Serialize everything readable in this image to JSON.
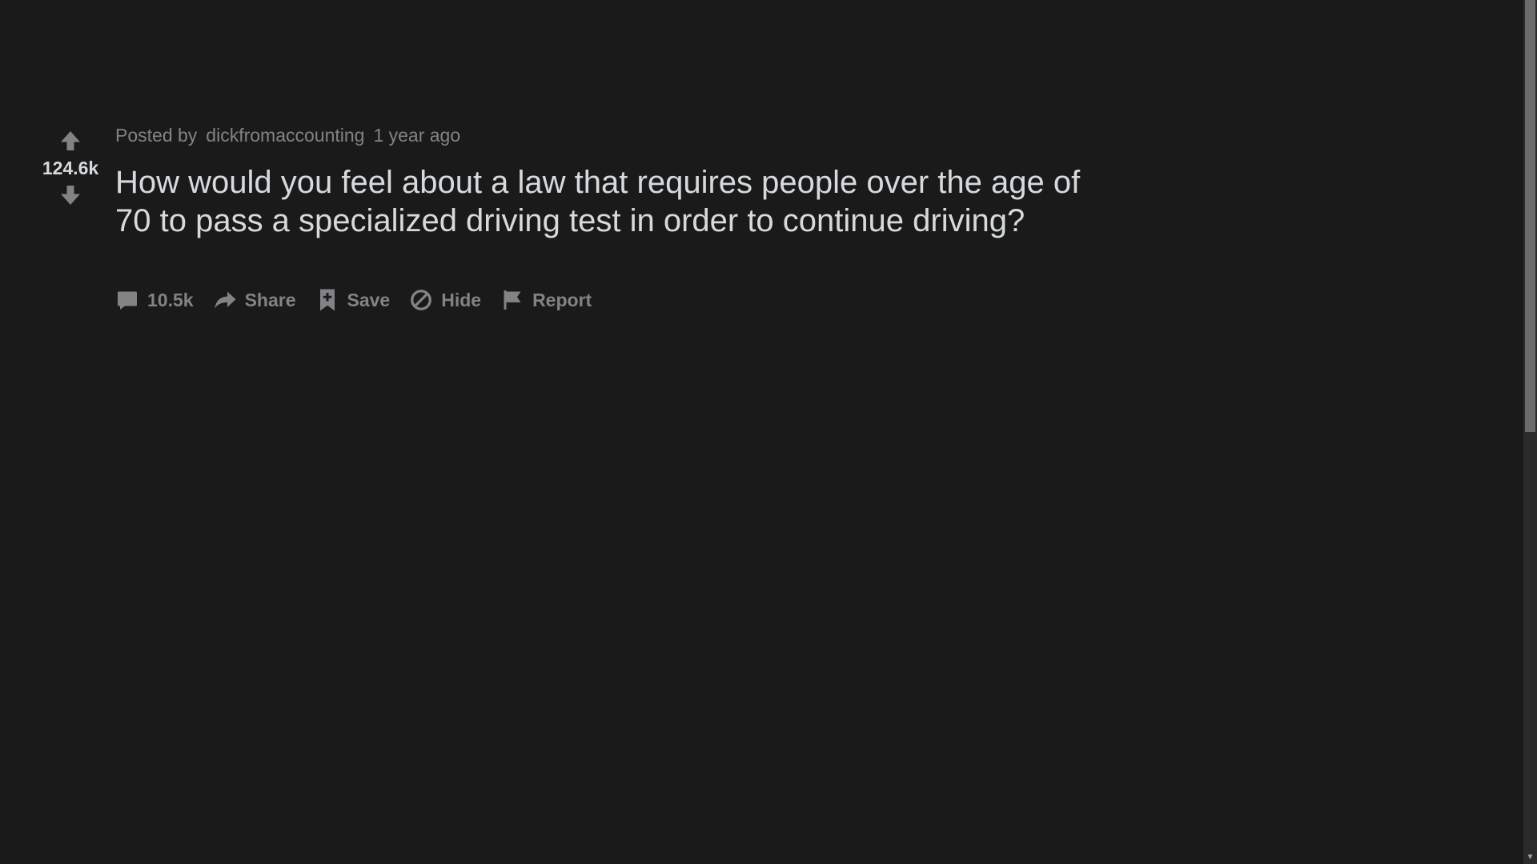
{
  "vote": {
    "score": "124.6k",
    "upvote_icon": "arrow-up-icon",
    "downvote_icon": "arrow-down-icon"
  },
  "post": {
    "posted_by_label": "Posted by",
    "author": "dickfromaccounting",
    "time_ago": "1 year ago",
    "title": "How would you feel about a law that requires people over the age of 70 to pass a specialized driving test in order to continue driving?"
  },
  "actions": {
    "comments_count": "10.5k",
    "share_label": "Share",
    "save_label": "Save",
    "hide_label": "Hide",
    "report_label": "Report"
  },
  "colors": {
    "background": "#1a1a1b",
    "text_primary": "#d7dadc",
    "text_muted": "#818384"
  }
}
